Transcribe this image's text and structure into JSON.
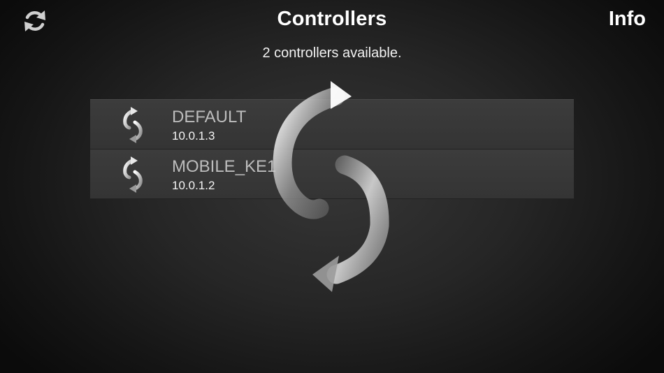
{
  "header": {
    "title": "Controllers",
    "info_label": "Info",
    "refresh_icon": "refresh-icon"
  },
  "status_text": "2 controllers available.",
  "controllers": [
    {
      "name": "DEFAULT",
      "ip": "10.0.1.3",
      "icon": "sync-arrows-icon"
    },
    {
      "name": "MOBILE_KE1",
      "ip": "10.0.1.2",
      "icon": "sync-arrows-icon"
    }
  ],
  "overlay": {
    "icon": "loading-sync-arrows-icon"
  }
}
